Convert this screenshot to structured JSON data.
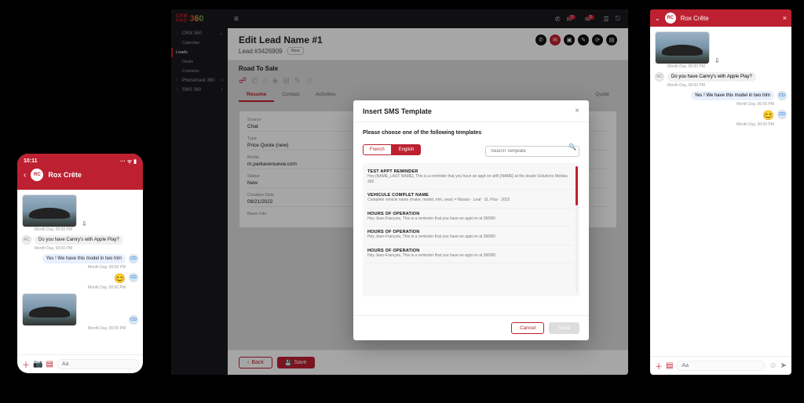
{
  "phone": {
    "time": "10:11",
    "signal": "··· ᯤ ▮",
    "contact": "Rox Crête",
    "contact_initials": "RC",
    "msgs": {
      "ts1": "Month Day, 00:00 PM",
      "m1": "Do you have Camry's with Apple Play?",
      "m2": "Yes ! We have this model in two trim",
      "co": "CO"
    },
    "placeholder": "Aa"
  },
  "desktop": {
    "brand1": "CRM",
    "brand2": "PRO",
    "brand3": "360",
    "nav": {
      "crm": "CRM 360",
      "calendar": "Calendar",
      "leads": "Leads",
      "deals": "Deals",
      "contacts": "Contacts",
      "phone": "Phonetrack 360",
      "sms": "SMS 360"
    },
    "top_badges": {
      "a": "2",
      "b": "3"
    },
    "title": "Edit Lead Name #1",
    "lead_no": "Lead #3426909",
    "tag": "New",
    "section": "Road To Sale",
    "tabs": {
      "resume": "Resume",
      "contact": "Contact",
      "activities": "Activities",
      "quote": "Quote"
    },
    "form": {
      "source_l": "Source",
      "source_v": "Chat",
      "type_l": "Type",
      "type_v": "Price Quote (new)",
      "media_l": "Media",
      "media_v": "m.parkavenuevw.com",
      "status_l": "Status",
      "status_v": "New",
      "date_l": "Creation Date",
      "date_v": "08/21/2022",
      "info_l": "Basic Info"
    },
    "back": "Back",
    "save": "Save"
  },
  "modal": {
    "title": "Insert SMS Template",
    "subtitle": "Please choose one of the following templates",
    "lang_fr": "French",
    "lang_en": "English",
    "search_ph": "Search Template",
    "tpl": [
      {
        "name": "TEST APPT REMINDER",
        "body": "Hey [NAME_LAST NAME],\nThis is a reminder that you have an appt on with [NAME] at the dealer Solutions Medias 360"
      },
      {
        "name": "VEHICULE COMPLET NAME",
        "body": "Complete vehicle name (make, model, trim, year) = Nissan · Leaf · SL Plus · 2022"
      },
      {
        "name": "HOURS OF OPERATION",
        "body": "Hey Jean-François,\nThis is a reminder that you have an appt on\nat 3M360"
      },
      {
        "name": "HOURS OF OPERATION",
        "body": "Hey Jean-François,\nThis is a reminder that you have an appt on\nat 3M360"
      },
      {
        "name": "HOURS OF OPERATION",
        "body": "Hey Jean-François,\nThis is a reminder that you have an appt on\nat 3M360"
      }
    ],
    "cancel": "Cancel",
    "save": "Save"
  },
  "chat": {
    "contact": "Rox Crête",
    "contact_initials": "RC",
    "placeholder": "Aa"
  }
}
